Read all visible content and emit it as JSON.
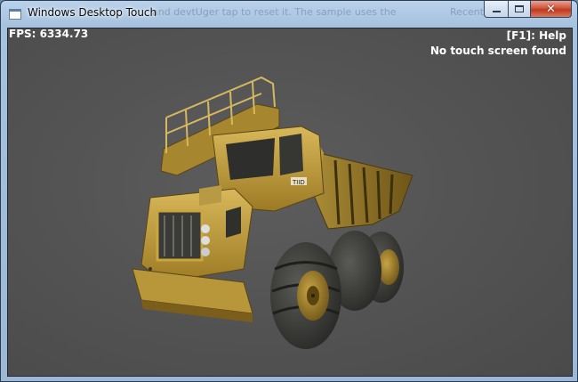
{
  "window": {
    "title": "Windows Desktop Touch",
    "background_text_1": "and devtUger tap to reset it. The sample uses the",
    "background_text_2": "Recent"
  },
  "hud": {
    "fps": "FPS: 6334.73",
    "help": "[F1]: Help",
    "touch_status": "No touch screen found"
  },
  "scene": {
    "model": "yellow dump truck",
    "cab_plate_text": "TIID"
  },
  "colors": {
    "viewport_bg": "#555555",
    "truck_yellow": "#c9a640",
    "tire": "#3a3a38"
  }
}
